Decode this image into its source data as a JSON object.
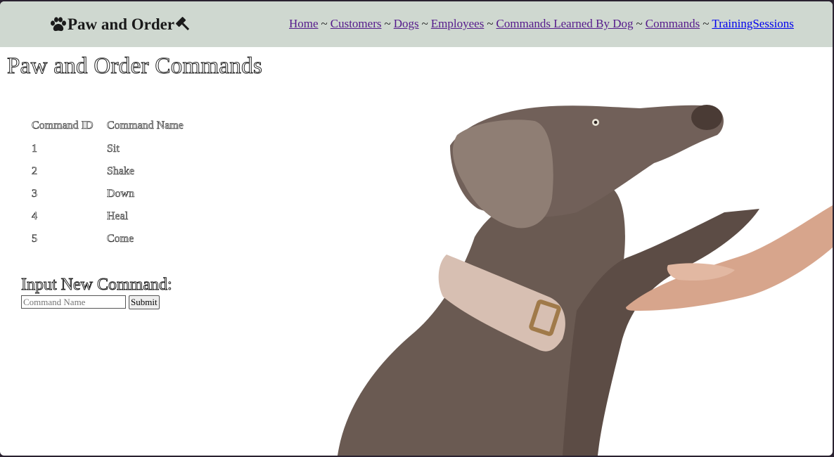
{
  "header": {
    "brand": "Paw and Order",
    "nav": [
      {
        "label": "Home",
        "visited": true
      },
      {
        "label": "Customers",
        "visited": true
      },
      {
        "label": "Dogs",
        "visited": true
      },
      {
        "label": "Employees",
        "visited": true
      },
      {
        "label": "Commands Learned By Dog",
        "visited": true
      },
      {
        "label": "Commands",
        "visited": true
      },
      {
        "label": "TrainingSessions",
        "visited": false
      }
    ],
    "separator": "~"
  },
  "page": {
    "title": "Paw and Order Commands"
  },
  "table": {
    "columns": [
      "Command ID",
      "Command Name"
    ],
    "rows": [
      [
        "1",
        "Sit"
      ],
      [
        "2",
        "Shake"
      ],
      [
        "3",
        "Down"
      ],
      [
        "4",
        "Heal"
      ],
      [
        "5",
        "Come"
      ]
    ]
  },
  "form": {
    "title": "Input New Command:",
    "input_placeholder": "Command Name",
    "submit_label": "Submit"
  },
  "icons": {
    "brand_left": "paw-icon",
    "brand_right": "gavel-icon"
  },
  "colors": {
    "header_bg": "#cfd8d0",
    "link_visited": "#551a8b",
    "link_unvisited": "#0000ee"
  }
}
